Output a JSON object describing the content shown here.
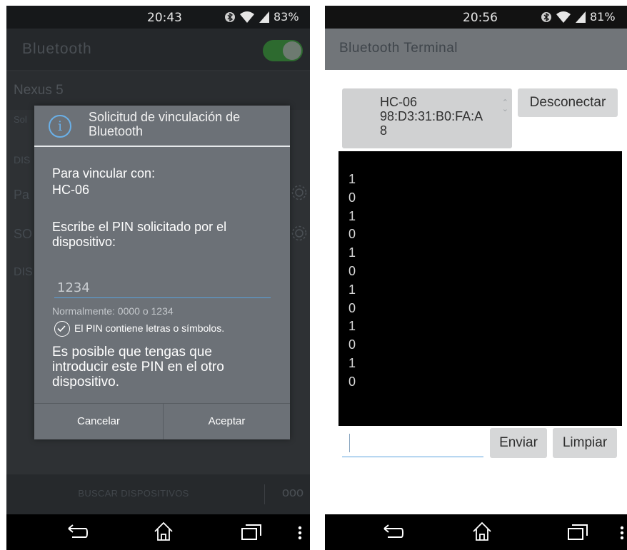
{
  "left": {
    "status": {
      "time": "20:43",
      "battery": "83%"
    },
    "appbar": {
      "title": "Bluetooth"
    },
    "paired_device": {
      "name": "Nexus 5"
    },
    "list_fragments": [
      "Sol",
      "DIS",
      "Pa",
      "SO",
      "DIS"
    ],
    "dialog": {
      "title": "Solicitud de vinculación de Bluetooth",
      "pair_label": "Para vincular con:",
      "device": "HC-06",
      "instruction": "Escribe el PIN solicitado por el dispositivo:",
      "pin_value": "1234",
      "hint": "Normalmente: 0000 o 1234",
      "checkbox_label": "El PIN contiene letras o símbolos.",
      "note": "Es posible que tengas que introducir este PIN en el otro dispositivo.",
      "cancel": "Cancelar",
      "accept": "Aceptar"
    },
    "bottombar": {
      "search": "BUSCAR DISPOSITIVOS",
      "more": "ooo"
    }
  },
  "right": {
    "status": {
      "time": "20:56",
      "battery": "81%"
    },
    "appbar": {
      "title": "Bluetooth Terminal"
    },
    "device_spinner": {
      "line1": "HC-06",
      "line2": "98:D3:31:B0:FA:A",
      "line3": "8"
    },
    "disconnect": "Desconectar",
    "terminal_lines": [
      "1",
      "0",
      "1",
      "0",
      "1",
      "0",
      "1",
      "0",
      "1",
      "0",
      "1",
      "0"
    ],
    "send": "Enviar",
    "clear": "Limpiar"
  },
  "colors": {
    "accent_blue": "#5aa2de",
    "toggle_on": "#2d6a2f",
    "dialog_bg": "#6c7177"
  },
  "icons": [
    "bluetooth-icon",
    "wifi-icon",
    "signal-icon",
    "battery",
    "info-icon",
    "gear-icon",
    "check-circle-icon",
    "back-icon",
    "home-icon",
    "recents-icon",
    "overflow-icon"
  ]
}
